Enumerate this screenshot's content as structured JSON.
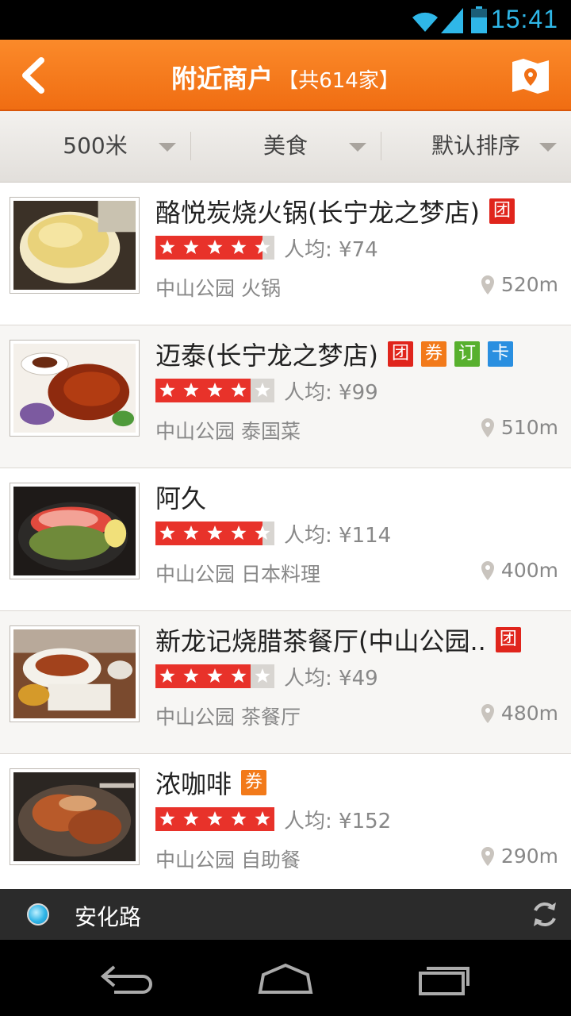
{
  "status_bar": {
    "time": "15:41"
  },
  "header": {
    "back_icon": "back-chevron-icon",
    "title": "附近商户",
    "count": "【共614家】",
    "map_icon": "map-pin-icon"
  },
  "filters": [
    {
      "label": "500米"
    },
    {
      "label": "美食"
    },
    {
      "label": "默认排序"
    }
  ],
  "merchants": [
    {
      "name": "酪悦炭烧火锅(长宁龙之梦店)",
      "badges": [
        "团"
      ],
      "rating": 4.5,
      "price": "人均: ¥74",
      "area": "中山公园 火锅",
      "distance": "520m"
    },
    {
      "name": "迈泰(长宁龙之梦店)",
      "badges": [
        "团",
        "券",
        "订",
        "卡"
      ],
      "rating": 4,
      "price": "人均: ¥99",
      "area": "中山公园 泰国菜",
      "distance": "510m"
    },
    {
      "name": "阿久",
      "badges": [],
      "rating": 4.5,
      "price": "人均: ¥114",
      "area": "中山公园 日本料理",
      "distance": "400m"
    },
    {
      "name": "新龙记烧腊茶餐厅(中山公园..",
      "badges": [
        "团"
      ],
      "rating": 4,
      "price": "人均: ¥49",
      "area": "中山公园 茶餐厅",
      "distance": "480m"
    },
    {
      "name": "浓咖啡",
      "badges": [
        "券"
      ],
      "rating": 5,
      "price": "人均: ¥152",
      "area": "中山公园 自助餐",
      "distance": "290m"
    }
  ],
  "location_bar": {
    "location": "安化路",
    "refresh_icon": "refresh-icon"
  },
  "colors": {
    "header": "#f47a1e",
    "badge_tuan": "#e0251c",
    "badge_quan": "#f27a1a",
    "badge_ding": "#58b02e",
    "badge_ka": "#2a8fe0",
    "star": "#e8322a",
    "status_time": "#2fb7e8"
  }
}
